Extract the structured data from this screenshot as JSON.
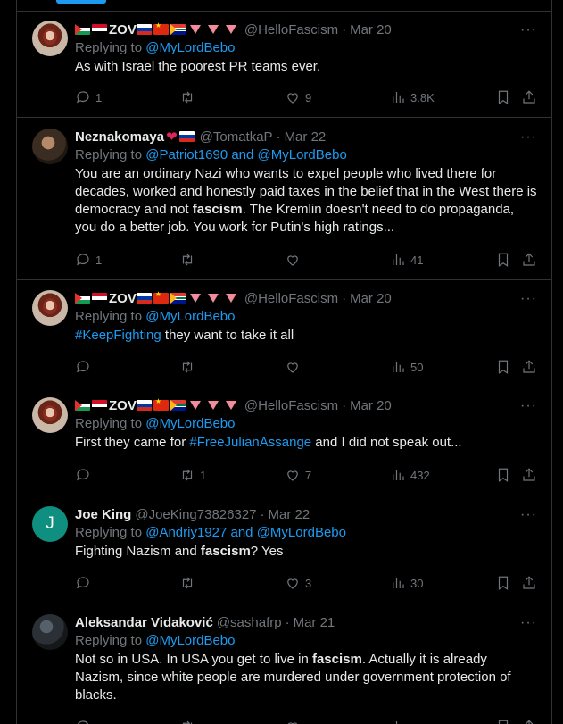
{
  "tweets": [
    {
      "name": "ZOV",
      "handle": "@HelloFascism",
      "date": "Mar 20",
      "replying_prefix": "Replying to",
      "replying_to": "@MyLordBebo",
      "text": "As with Israel the poorest PR teams ever.",
      "replies": "1",
      "retweets": "",
      "likes": "9",
      "views": "3.8K"
    },
    {
      "name": "Neznakomaya",
      "handle": "@TomatkaP",
      "date": "Mar 22",
      "replying_prefix": "Replying to",
      "replying_to": "@Patriot1690 and @MyLordBebo",
      "text_before": "You are an ordinary Nazi who wants to expel people who lived there for decades, worked and honestly paid taxes in the belief that in the West there is democracy and not ",
      "text_bold": "fascism",
      "text_after": ". The Kremlin doesn't need to do propaganda, you do a better job. You work for Putin's high ratings...",
      "replies": "1",
      "retweets": "",
      "likes": "",
      "views": "41"
    },
    {
      "name": "ZOV",
      "handle": "@HelloFascism",
      "date": "Mar 20",
      "replying_prefix": "Replying to",
      "replying_to": "@MyLordBebo",
      "hashtag": "#KeepFighting",
      "text": " they want to take it all",
      "replies": "",
      "retweets": "",
      "likes": "",
      "views": "50"
    },
    {
      "name": "ZOV",
      "handle": "@HelloFascism",
      "date": "Mar 20",
      "replying_prefix": "Replying to",
      "replying_to": "@MyLordBebo",
      "text_before": "First they came for ",
      "hashtag": "#FreeJulianAssange",
      "text_after": " and I did not speak out...",
      "replies": "",
      "retweets": "1",
      "likes": "7",
      "views": "432"
    },
    {
      "name": "Joe King",
      "avatar_letter": "J",
      "handle": "@JoeKing73826327",
      "date": "Mar 22",
      "replying_prefix": "Replying to",
      "replying_to": "@Andriy1927 and @MyLordBebo",
      "text_before": "Fighting Nazism and ",
      "text_bold": "fascism",
      "text_after": "? Yes",
      "replies": "",
      "retweets": "",
      "likes": "3",
      "views": "30"
    },
    {
      "name": "Aleksandar Vidaković",
      "handle": "@sashafrp",
      "date": "Mar 21",
      "replying_prefix": "Replying to",
      "replying_to": "@MyLordBebo",
      "text_before": "Not so in USA. In USA you get to live in ",
      "text_bold": "fascism",
      "text_after": ". Actually it is already Nazism, since white people are murdered under government protection of blacks."
    }
  ],
  "colors": {
    "background": "#000000",
    "text": "#e7e9ea",
    "muted": "#71767b",
    "link": "#1d9bf0",
    "divider": "#2f3336"
  },
  "icons": [
    "reply-icon",
    "retweet-icon",
    "like-icon",
    "views-icon",
    "bookmark-icon",
    "share-icon",
    "more-icon"
  ]
}
